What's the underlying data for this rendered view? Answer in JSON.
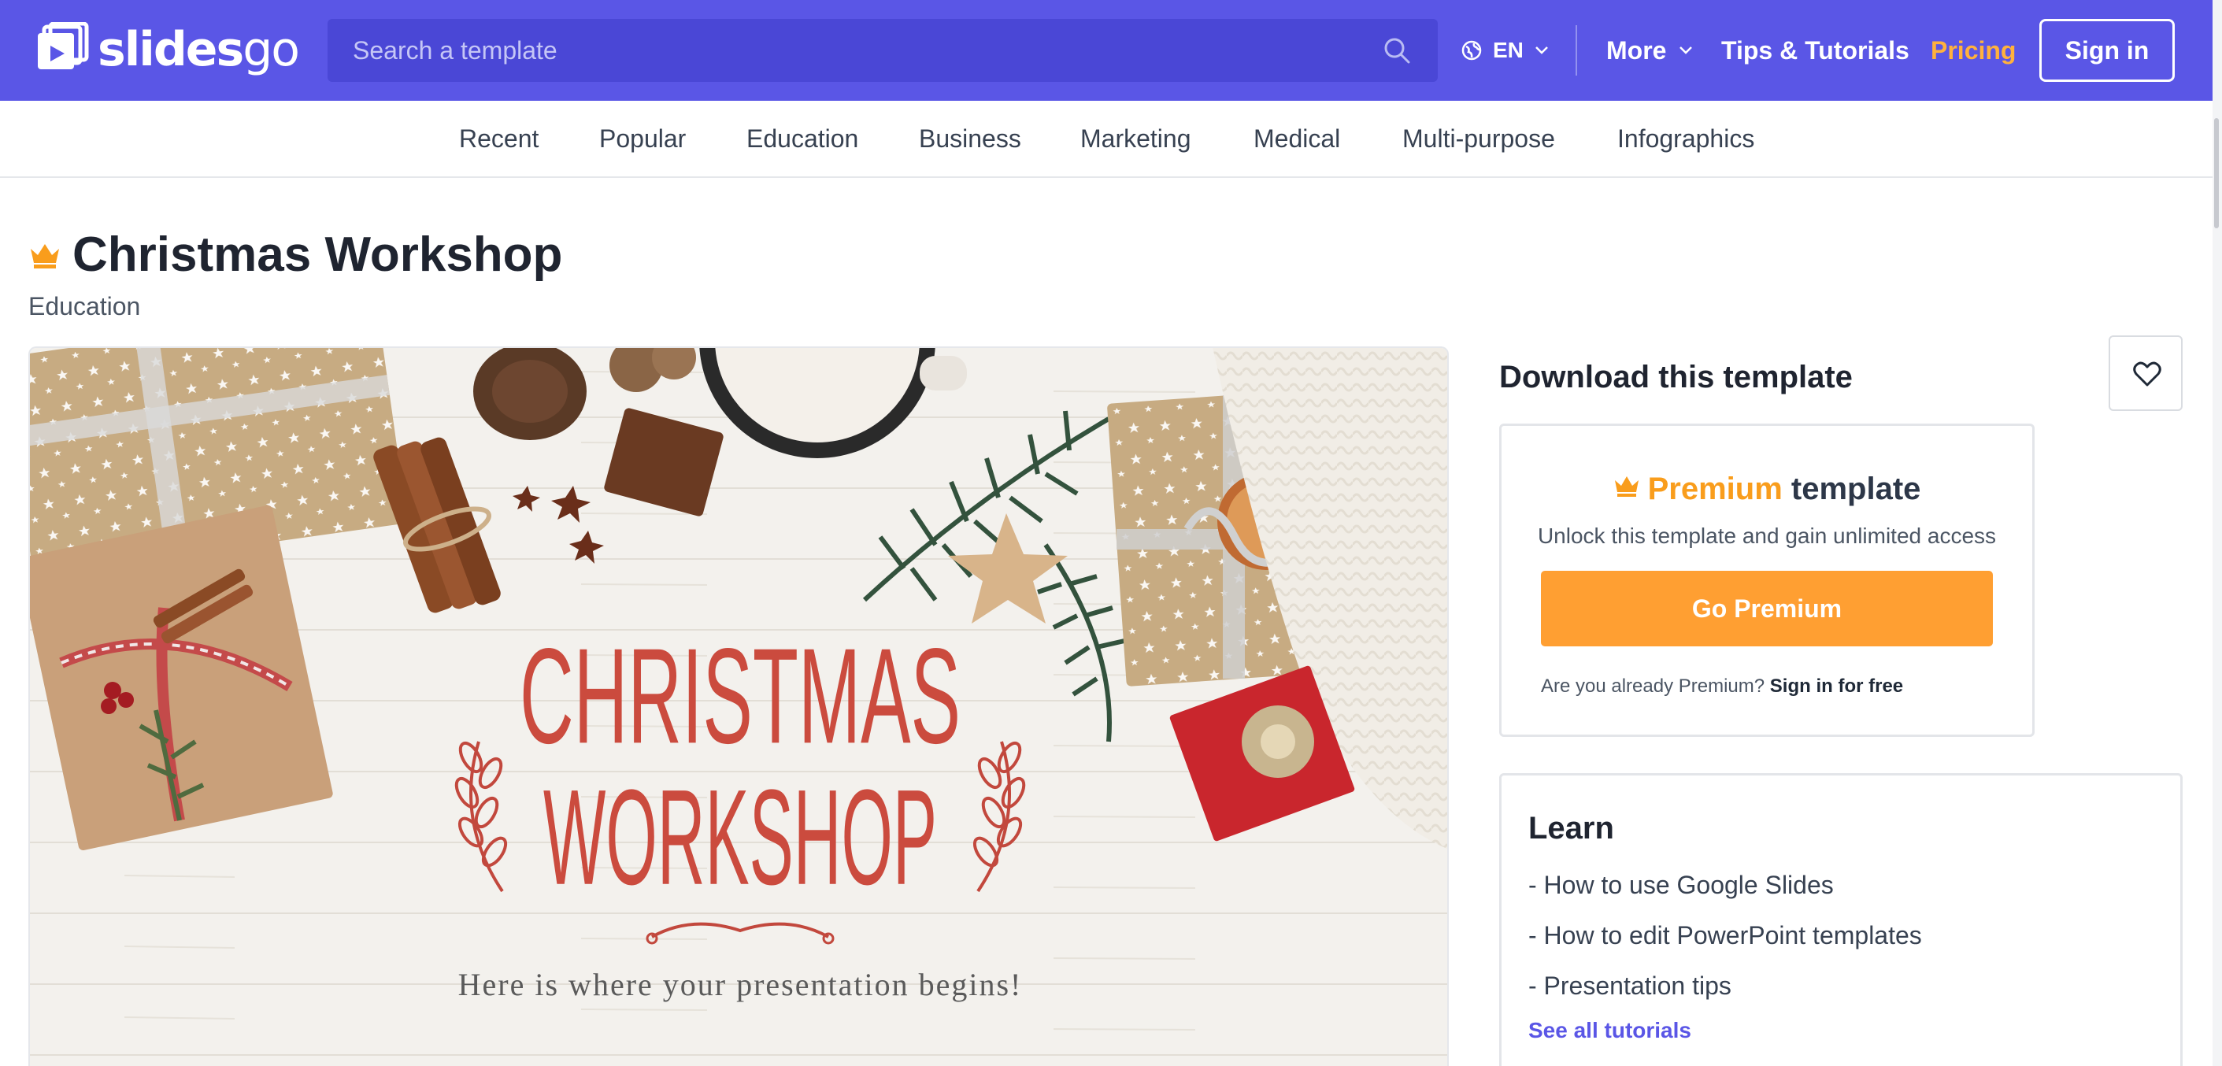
{
  "header": {
    "logo_text_bold": "slides",
    "logo_text_light": "go",
    "search_placeholder": "Search a template",
    "language": "EN",
    "more_label": "More",
    "tips_label": "Tips & Tutorials",
    "pricing_label": "Pricing",
    "signin_label": "Sign in",
    "colors": {
      "bar": "#5a56e6",
      "search": "#4a47d6",
      "pricing": "#ffb13d"
    }
  },
  "categories": [
    "Recent",
    "Popular",
    "Education",
    "Business",
    "Marketing",
    "Medical",
    "Multi-purpose",
    "Infographics"
  ],
  "template": {
    "title": "Christmas Workshop",
    "category": "Education",
    "preview": {
      "headline_line1": "CHRISTMAS",
      "headline_line2": "WORKSHOP",
      "tagline": "Here is where your presentation begins!"
    }
  },
  "download": {
    "title": "Download this template",
    "favorite_icon": "heart-icon",
    "premium_word": "Premium",
    "template_word": "template",
    "subtitle": "Unlock this template and gain unlimited access",
    "button_label": "Go Premium",
    "already_text": "Are you already Premium?",
    "signin_free": "Sign in for free",
    "accent": "#ff9f32"
  },
  "learn": {
    "title": "Learn",
    "items": [
      "- How to use Google Slides",
      "- How to edit PowerPoint templates",
      "- Presentation tips"
    ],
    "see_all": "See all tutorials"
  }
}
